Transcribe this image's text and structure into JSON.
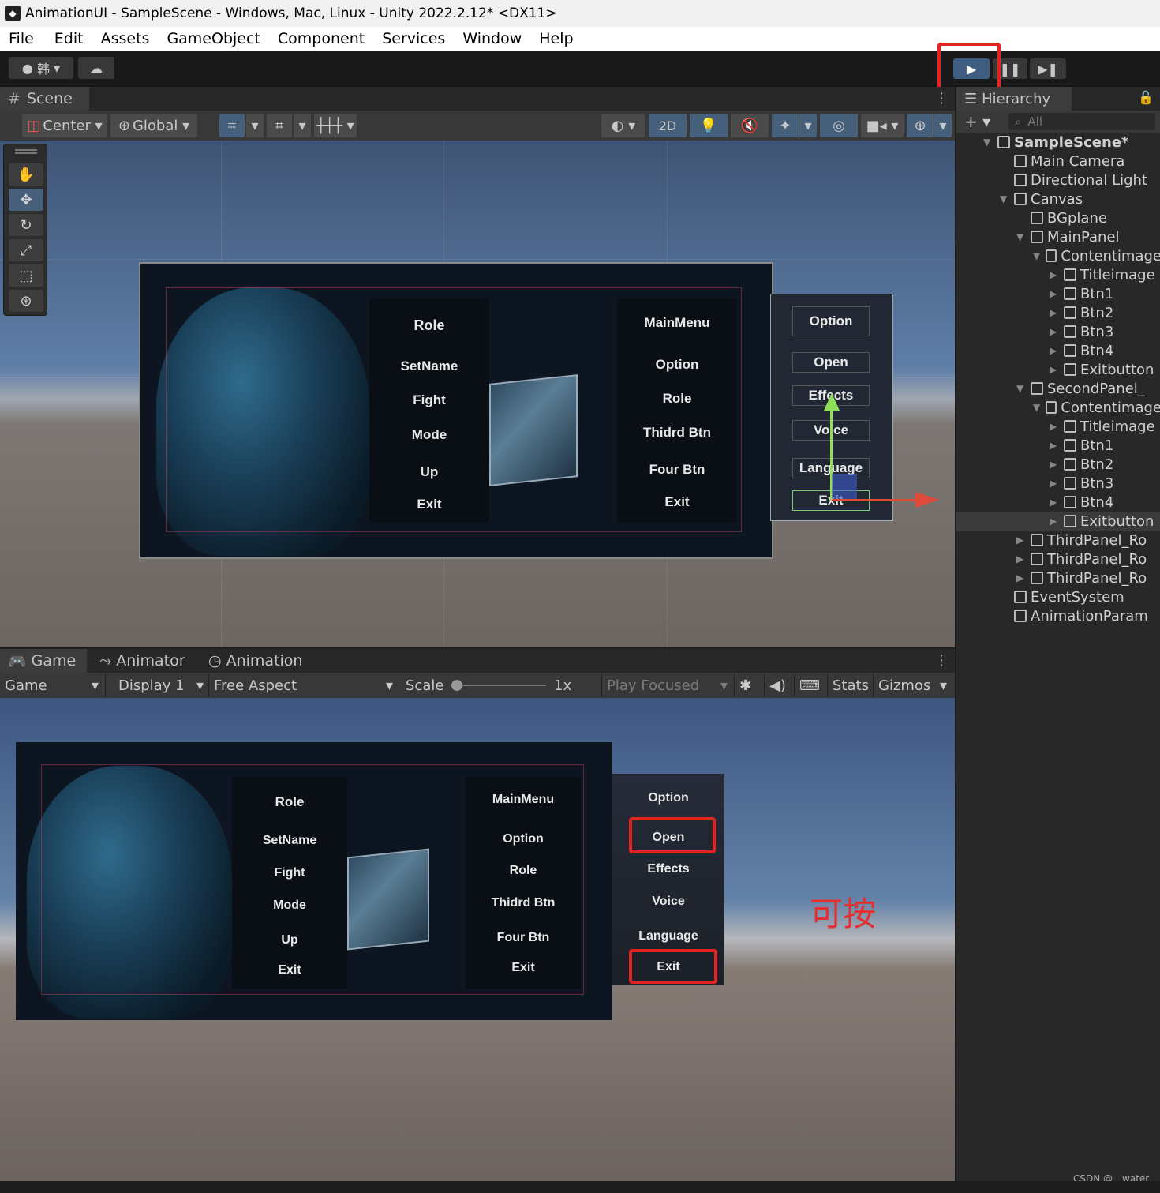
{
  "title": "AnimationUI - SampleScene - Windows, Mac, Linux - Unity 2022.2.12* <DX11>",
  "menu": [
    "File",
    "Edit",
    "Assets",
    "GameObject",
    "Component",
    "Services",
    "Window",
    "Help"
  ],
  "toolbar": {
    "account": "韩"
  },
  "scene": {
    "tab": "Scene",
    "pivot": "Center",
    "space": "Global",
    "mode2d": "2D"
  },
  "hierarchy": {
    "tab": "Hierarchy",
    "search_placeholder": "All",
    "rows": [
      {
        "label": "SampleScene*",
        "indent": 0,
        "arrow": "▼",
        "bold": true
      },
      {
        "label": "Main Camera",
        "indent": 1,
        "arrow": ""
      },
      {
        "label": "Directional Light",
        "indent": 1,
        "arrow": ""
      },
      {
        "label": "Canvas",
        "indent": 1,
        "arrow": "▼"
      },
      {
        "label": "BGplane",
        "indent": 2,
        "arrow": ""
      },
      {
        "label": "MainPanel",
        "indent": 2,
        "arrow": "▼"
      },
      {
        "label": "Contentimage",
        "indent": 3,
        "arrow": "▼"
      },
      {
        "label": "Titleimage",
        "indent": 4,
        "arrow": "▶"
      },
      {
        "label": "Btn1",
        "indent": 4,
        "arrow": "▶"
      },
      {
        "label": "Btn2",
        "indent": 4,
        "arrow": "▶"
      },
      {
        "label": "Btn3",
        "indent": 4,
        "arrow": "▶"
      },
      {
        "label": "Btn4",
        "indent": 4,
        "arrow": "▶"
      },
      {
        "label": "Exitbutton",
        "indent": 4,
        "arrow": "▶"
      },
      {
        "label": "SecondPanel_",
        "indent": 2,
        "arrow": "▼"
      },
      {
        "label": "Contentimage",
        "indent": 3,
        "arrow": "▼"
      },
      {
        "label": "Titleimage",
        "indent": 4,
        "arrow": "▶"
      },
      {
        "label": "Btn1",
        "indent": 4,
        "arrow": "▶"
      },
      {
        "label": "Btn2",
        "indent": 4,
        "arrow": "▶"
      },
      {
        "label": "Btn3",
        "indent": 4,
        "arrow": "▶"
      },
      {
        "label": "Btn4",
        "indent": 4,
        "arrow": "▶"
      },
      {
        "label": "Exitbutton",
        "indent": 4,
        "arrow": "▶",
        "selected": true
      },
      {
        "label": "ThirdPanel_Ro",
        "indent": 2,
        "arrow": "▶"
      },
      {
        "label": "ThirdPanel_Ro",
        "indent": 2,
        "arrow": "▶"
      },
      {
        "label": "ThirdPanel_Ro",
        "indent": 2,
        "arrow": "▶"
      },
      {
        "label": "EventSystem",
        "indent": 1,
        "arrow": ""
      },
      {
        "label": "AnimationParam",
        "indent": 1,
        "arrow": ""
      }
    ]
  },
  "panels": {
    "left": [
      "Role",
      "SetName",
      "Fight",
      "Mode",
      "Up",
      "Exit"
    ],
    "middle": [
      "MainMenu",
      "Option",
      "Role",
      "Thidrd Btn",
      "Four Btn",
      "Exit"
    ],
    "right": [
      "Option",
      "Open",
      "Effects",
      "Voice",
      "Language",
      "Exit"
    ]
  },
  "game": {
    "tabs": [
      "Game",
      "Animator",
      "Animation"
    ],
    "view_mode": "Game",
    "display": "Display 1",
    "aspect": "Free Aspect",
    "scale_label": "Scale",
    "scale_value": "1x",
    "play_focused": "Play Focused",
    "stats": "Stats",
    "gizmos": "Gizmos"
  },
  "annotation": "可按",
  "watermark": "CSDN @__water"
}
